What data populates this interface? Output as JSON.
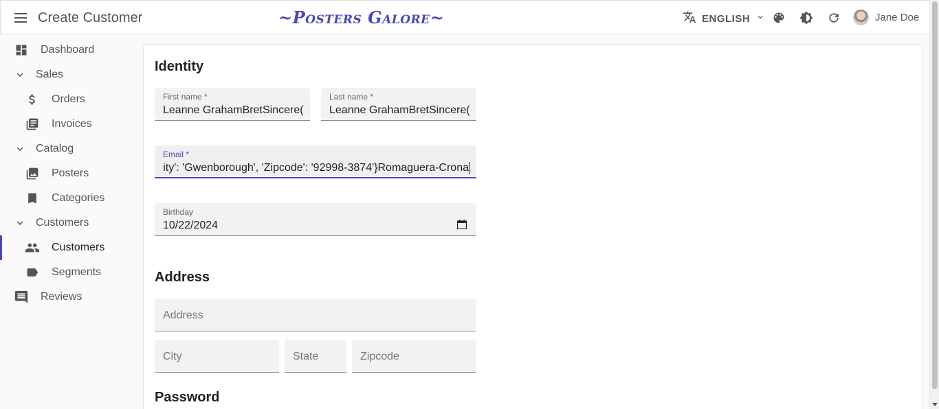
{
  "app": {
    "page_title": "Create Customer",
    "brand": "~Posters Galore~",
    "language": "ENGLISH",
    "user_name": "Jane Doe"
  },
  "sidebar": {
    "items": [
      {
        "label": "Dashboard",
        "icon": "dashboard-icon"
      },
      {
        "label": "Sales",
        "icon": "chevron-down-icon"
      },
      {
        "label": "Orders",
        "icon": "dollar-icon"
      },
      {
        "label": "Invoices",
        "icon": "invoices-icon"
      },
      {
        "label": "Catalog",
        "icon": "chevron-down-icon"
      },
      {
        "label": "Posters",
        "icon": "image-icon"
      },
      {
        "label": "Categories",
        "icon": "bookmark-icon"
      },
      {
        "label": "Customers",
        "icon": "chevron-down-icon"
      },
      {
        "label": "Customers",
        "icon": "people-icon"
      },
      {
        "label": "Segments",
        "icon": "label-icon"
      },
      {
        "label": "Reviews",
        "icon": "comment-icon"
      }
    ]
  },
  "form": {
    "identity_title": "Identity",
    "first_name": {
      "label": "First name *",
      "value": "Leanne GrahamBretSincere("
    },
    "last_name": {
      "label": "Last name *",
      "value": "Leanne GrahamBretSincere("
    },
    "email": {
      "label": "Email *",
      "value": "ity': 'Gwenborough', 'Zipcode': '92998-3874'}Romaguera-Crona"
    },
    "birthday": {
      "label": "Birthday",
      "value": "10/22/2024"
    },
    "address_title": "Address",
    "address_placeholder": "Address",
    "city_placeholder": "City",
    "state_placeholder": "State",
    "zipcode_placeholder": "Zipcode",
    "password_title": "Password"
  },
  "colors": {
    "accent": "#4a48b8"
  }
}
